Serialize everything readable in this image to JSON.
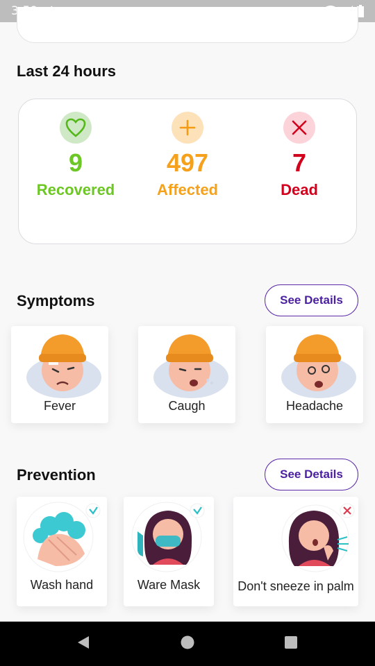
{
  "status": {
    "time": "3:59",
    "settings_icon": "gear-icon"
  },
  "last24": {
    "title": "Last 24 hours",
    "recovered": {
      "value": "9",
      "label": "Recovered",
      "color": "#6cc623",
      "icon": "heart-icon"
    },
    "affected": {
      "value": "497",
      "label": "Affected",
      "color": "#f5a11c",
      "icon": "plus-icon"
    },
    "dead": {
      "value": "7",
      "label": "Dead",
      "color": "#d1001c",
      "icon": "close-icon"
    }
  },
  "symptoms": {
    "title": "Symptoms",
    "see_details": "See Details",
    "items": [
      {
        "label": "Fever"
      },
      {
        "label": "Caugh"
      },
      {
        "label": "Headache"
      }
    ]
  },
  "prevention": {
    "title": "Prevention",
    "see_details": "See Details",
    "items": [
      {
        "label": "Wash hand",
        "mark": "check"
      },
      {
        "label": "Ware Mask",
        "mark": "check"
      },
      {
        "label": "Don't sneeze in palm",
        "mark": "cross"
      }
    ]
  },
  "colors": {
    "accent": "#4a1fa0",
    "check": "#2bbfc6",
    "cross": "#e0394e"
  }
}
